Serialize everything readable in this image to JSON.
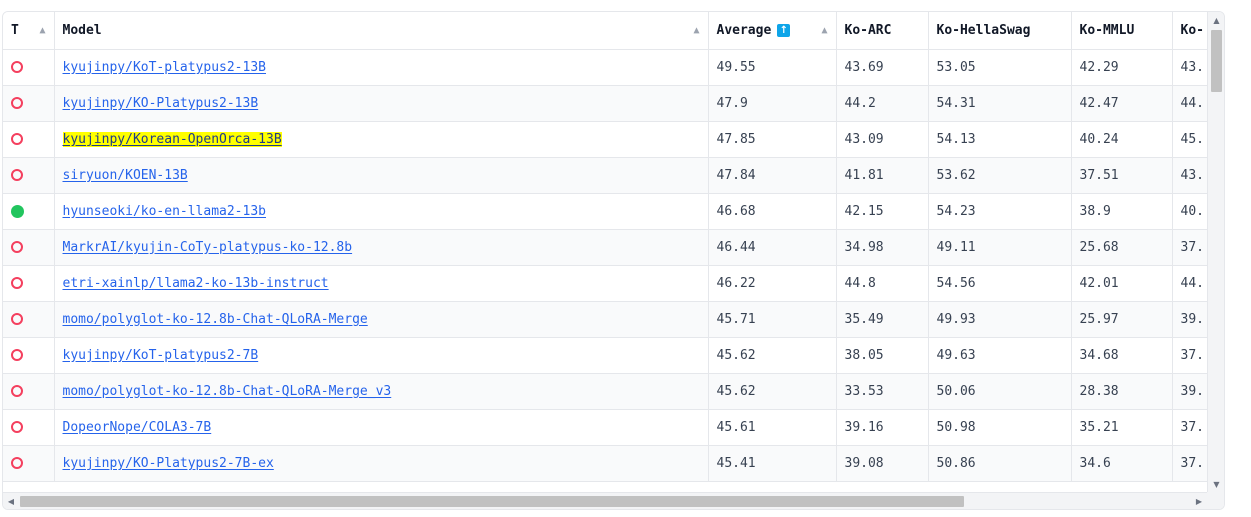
{
  "columns": [
    {
      "label": "T",
      "sort_icon": "triangle-up-icon"
    },
    {
      "label": "Model",
      "sort_icon": "triangle-up-icon"
    },
    {
      "label": "Average",
      "badge_icon": "sort-up-arrow-icon",
      "badge_glyph": "↑",
      "sort_icon": "triangle-up-icon"
    },
    {
      "label": "Ko-ARC"
    },
    {
      "label": "Ko-HellaSwag"
    },
    {
      "label": "Ko-MMLU"
    },
    {
      "label": "Ko-"
    }
  ],
  "rows": [
    {
      "type": "ring",
      "model": "kyujinpy/KoT-platypus2-13B",
      "average": "49.55",
      "arc": "43.69",
      "hellaswag": "53.05",
      "mmlu": "42.29",
      "next": "43."
    },
    {
      "type": "ring",
      "model": "kyujinpy/KO-Platypus2-13B",
      "average": "47.9",
      "arc": "44.2",
      "hellaswag": "54.31",
      "mmlu": "42.47",
      "next": "44."
    },
    {
      "type": "ring",
      "model": "kyujinpy/Korean-OpenOrca-13B",
      "average": "47.85",
      "arc": "43.09",
      "hellaswag": "54.13",
      "mmlu": "40.24",
      "next": "45.",
      "highlighted": true
    },
    {
      "type": "ring",
      "model": "siryuon/KOEN-13B",
      "average": "47.84",
      "arc": "41.81",
      "hellaswag": "53.62",
      "mmlu": "37.51",
      "next": "43."
    },
    {
      "type": "dot",
      "model": "hyunseoki/ko-en-llama2-13b",
      "average": "46.68",
      "arc": "42.15",
      "hellaswag": "54.23",
      "mmlu": "38.9",
      "next": "40."
    },
    {
      "type": "ring",
      "model": "MarkrAI/kyujin-CoTy-platypus-ko-12.8b",
      "average": "46.44",
      "arc": "34.98",
      "hellaswag": "49.11",
      "mmlu": "25.68",
      "next": "37."
    },
    {
      "type": "ring",
      "model": "etri-xainlp/llama2-ko-13b-instruct",
      "average": "46.22",
      "arc": "44.8",
      "hellaswag": "54.56",
      "mmlu": "42.01",
      "next": "44."
    },
    {
      "type": "ring",
      "model": "momo/polyglot-ko-12.8b-Chat-QLoRA-Merge",
      "average": "45.71",
      "arc": "35.49",
      "hellaswag": "49.93",
      "mmlu": "25.97",
      "next": "39."
    },
    {
      "type": "ring",
      "model": "kyujinpy/KoT-platypus2-7B",
      "average": "45.62",
      "arc": "38.05",
      "hellaswag": "49.63",
      "mmlu": "34.68",
      "next": "37."
    },
    {
      "type": "ring",
      "model": "momo/polyglot-ko-12.8b-Chat-QLoRA-Merge_v3",
      "average": "45.62",
      "arc": "33.53",
      "hellaswag": "50.06",
      "mmlu": "28.38",
      "next": "39."
    },
    {
      "type": "ring",
      "model": "DopeorNope/COLA3-7B",
      "average": "45.61",
      "arc": "39.16",
      "hellaswag": "50.98",
      "mmlu": "35.21",
      "next": "37."
    },
    {
      "type": "ring",
      "model": "kyujinpy/KO-Platypus2-7B-ex",
      "average": "45.41",
      "arc": "39.08",
      "hellaswag": "50.86",
      "mmlu": "34.6",
      "next": "37."
    }
  ],
  "icons": {
    "ring": "ring-icon (pretrained)",
    "dot": "filled-circle-icon (fine-tuned)"
  },
  "colors": {
    "ring": "#f43f5e",
    "dot": "#22c55e",
    "link": "#2563eb",
    "highlight": "#ffff00",
    "badge": "#0ea5e9"
  }
}
